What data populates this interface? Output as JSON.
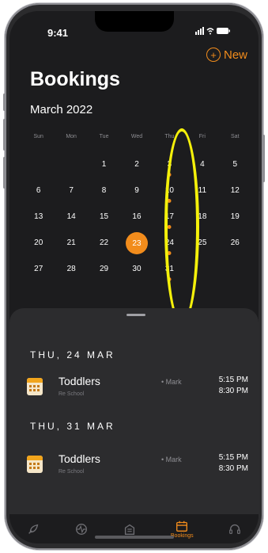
{
  "status": {
    "time": "9:41",
    "icons": "..ll ≈ ▬"
  },
  "header": {
    "title": "Bookings",
    "month": "March 2022",
    "new_label": "New"
  },
  "weekdays": [
    "Sun",
    "Mon",
    "Tue",
    "Wed",
    "Thu",
    "Fri",
    "Sat"
  ],
  "calendar": {
    "rows": [
      [
        "",
        "",
        "1",
        "2",
        "3",
        "4",
        "5"
      ],
      [
        "6",
        "7",
        "8",
        "9",
        "10",
        "11",
        "12"
      ],
      [
        "13",
        "14",
        "15",
        "16",
        "17",
        "18",
        "19"
      ],
      [
        "20",
        "21",
        "22",
        "23",
        "24",
        "25",
        "26"
      ],
      [
        "27",
        "28",
        "29",
        "30",
        "31",
        "",
        ""
      ]
    ],
    "selected_day": "23",
    "days_with_events": [
      "3",
      "10",
      "17",
      "24",
      "31"
    ]
  },
  "bookings": [
    {
      "date": "THU, 24 MAR",
      "title": "Toddlers",
      "subtitle": "Re School",
      "person": "• Mark",
      "start": "5:15 PM",
      "end": "8:30 PM"
    },
    {
      "date": "THU, 31 MAR",
      "title": "Toddlers",
      "subtitle": "Re School",
      "person": "• Mark",
      "start": "5:15 PM",
      "end": "8:30 PM"
    }
  ],
  "tabs": [
    {
      "icon": "rocket-icon",
      "label": ""
    },
    {
      "icon": "activity-icon",
      "label": ""
    },
    {
      "icon": "building-icon",
      "label": ""
    },
    {
      "icon": "calendar-icon",
      "label": "Bookings",
      "active": true
    },
    {
      "icon": "support-icon",
      "label": ""
    }
  ],
  "colors": {
    "accent": "#f28c1c",
    "annotation": "#f4f00a",
    "background": "#1c1c1e",
    "sheet": "#2c2c2e"
  }
}
